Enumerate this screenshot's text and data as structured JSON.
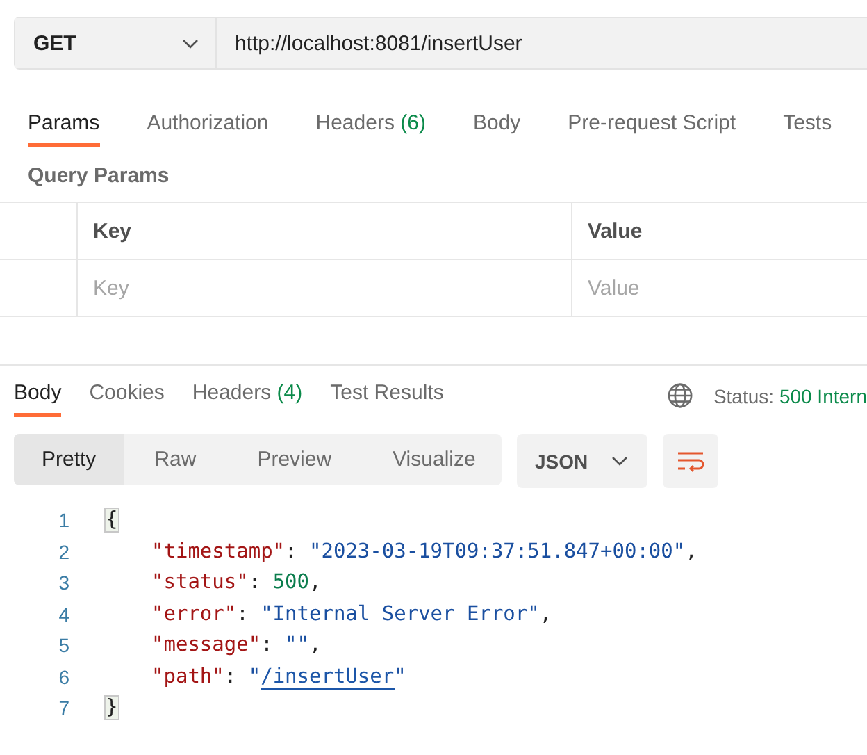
{
  "request": {
    "method": "GET",
    "url": "http://localhost:8081/insertUser"
  },
  "request_tabs": [
    {
      "label": "Params",
      "selected": true
    },
    {
      "label": "Authorization",
      "selected": false
    },
    {
      "label": "Headers",
      "count": "(6)",
      "selected": false
    },
    {
      "label": "Body",
      "selected": false
    },
    {
      "label": "Pre-request Script",
      "selected": false
    },
    {
      "label": "Tests",
      "selected": false
    }
  ],
  "query_params": {
    "title": "Query Params",
    "columns": [
      "Key",
      "Value"
    ],
    "placeholders": [
      "Key",
      "Value"
    ]
  },
  "response_tabs": [
    {
      "label": "Body",
      "selected": true
    },
    {
      "label": "Cookies",
      "selected": false
    },
    {
      "label": "Headers",
      "count": "(4)",
      "selected": false
    },
    {
      "label": "Test Results",
      "selected": false
    }
  ],
  "status": {
    "label": "Status:",
    "value": "500 Intern"
  },
  "view_modes": [
    {
      "label": "Pretty",
      "selected": true
    },
    {
      "label": "Raw",
      "selected": false
    },
    {
      "label": "Preview",
      "selected": false
    },
    {
      "label": "Visualize",
      "selected": false
    }
  ],
  "format": "JSON",
  "code_lines": [
    {
      "number": "1",
      "tokens": [
        {
          "kind": "bracket",
          "text": "{"
        }
      ]
    },
    {
      "number": "2",
      "tokens": [
        {
          "kind": "key",
          "text": "\"timestamp\""
        },
        {
          "kind": "punct",
          "text": ": "
        },
        {
          "kind": "string",
          "text": "\"2023-03-19T09:37:51.847+00:00\""
        },
        {
          "kind": "punct",
          "text": ","
        }
      ]
    },
    {
      "number": "3",
      "tokens": [
        {
          "kind": "key",
          "text": "\"status\""
        },
        {
          "kind": "punct",
          "text": ": "
        },
        {
          "kind": "number",
          "text": "500"
        },
        {
          "kind": "punct",
          "text": ","
        }
      ]
    },
    {
      "number": "4",
      "tokens": [
        {
          "kind": "key",
          "text": "\"error\""
        },
        {
          "kind": "punct",
          "text": ": "
        },
        {
          "kind": "string",
          "text": "\"Internal Server Error\""
        },
        {
          "kind": "punct",
          "text": ","
        }
      ]
    },
    {
      "number": "5",
      "tokens": [
        {
          "kind": "key",
          "text": "\"message\""
        },
        {
          "kind": "punct",
          "text": ": "
        },
        {
          "kind": "string",
          "text": "\"\""
        },
        {
          "kind": "punct",
          "text": ","
        }
      ]
    },
    {
      "number": "6",
      "tokens": [
        {
          "kind": "key",
          "text": "\"path\""
        },
        {
          "kind": "punct",
          "text": ": "
        },
        {
          "kind": "string",
          "text": "\""
        },
        {
          "kind": "link",
          "text": "/insertUser"
        },
        {
          "kind": "string",
          "text": "\""
        }
      ]
    },
    {
      "number": "7",
      "tokens": [
        {
          "kind": "bracket",
          "text": "}"
        }
      ]
    }
  ]
}
